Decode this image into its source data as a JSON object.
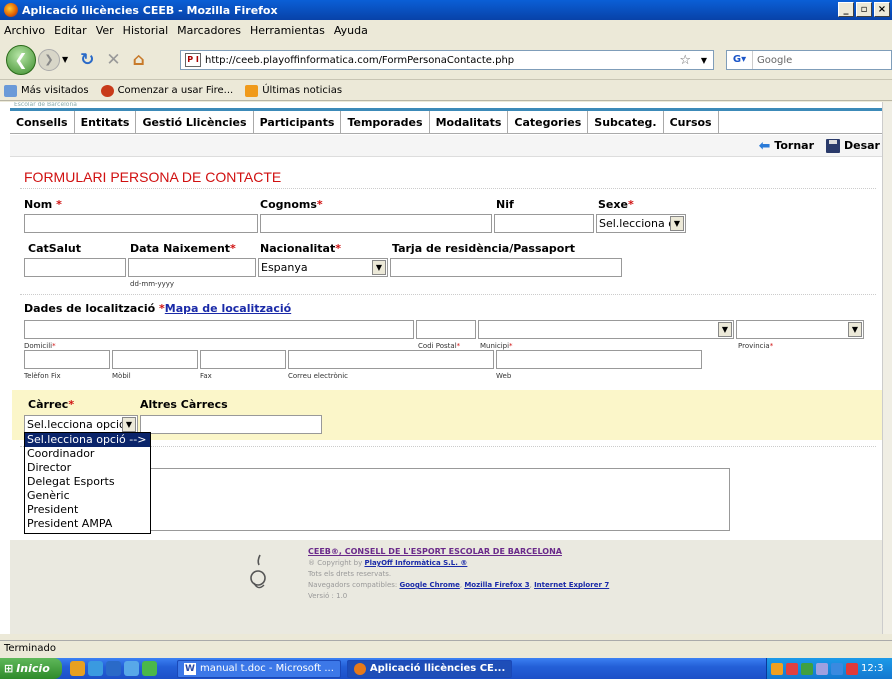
{
  "window": {
    "title": "Aplicació llicències CEEB - Mozilla Firefox"
  },
  "menu": [
    "Archivo",
    "Editar",
    "Ver",
    "Historial",
    "Marcadores",
    "Herramientas",
    "Ayuda"
  ],
  "nav": {
    "url": "http://ceeb.playoffinformatica.com/FormPersonaContacte.php",
    "favicon": "P I",
    "search_placeholder": "Google"
  },
  "bookmarks": [
    "Más visitados",
    "Comenzar a usar Fire...",
    "Últimas noticias"
  ],
  "site": {
    "subheader": "Escolar de Barcelona",
    "tabs": [
      "Consells",
      "Entitats",
      "Gestió Llicències",
      "Participants",
      "Temporades",
      "Modalitats",
      "Categories",
      "Subcateg.",
      "Cursos"
    ],
    "actions": {
      "back": "Tornar",
      "save": "Desar"
    }
  },
  "form": {
    "title": "FORMULARI PERSONA DE CONTACTE",
    "labels": {
      "nom": "Nom",
      "cognoms": "Cognoms",
      "nif": "Nif",
      "sexe": "Sexe",
      "catsalut": "CatSalut",
      "data_naixement": "Data Naixement",
      "nacionalitat": "Nacionalitat",
      "tarja": "Tarja de residència/Passaport",
      "dades": "Dades de localització",
      "mapa": "Mapa de localització",
      "carrec": "Càrrec",
      "altres": "Altres Càrrecs"
    },
    "required_mark": "*",
    "sexe_value": "Sel.lecciona o",
    "date_hint": "dd-mm-yyyy",
    "nacionalitat_value": "Espanya",
    "small_labels": {
      "domicili": "Domicili",
      "codi_postal": "Codi Postal",
      "municipi": "Municipi",
      "provincia": "Provincia",
      "telefon": "Telèfon Fix",
      "mobil": "Mòbil",
      "fax": "Fax",
      "correu": "Correu electrònic",
      "web": "Web"
    },
    "carrec_value": "Sel.lecciona opció",
    "carrec_options": [
      "Sel.lecciona opció -->",
      "Coordinador",
      "Director",
      "Delegat Esports",
      "Genèric",
      "President",
      "President AMPA"
    ]
  },
  "footer": {
    "org": "CEEB®, CONSELL DE L'ESPORT ESCOLAR DE BARCELONA",
    "copyright_prefix": "® Copyright by",
    "copyright_link": "PlayOff Informàtica S.L. ®",
    "rights": "Tots els drets reservats.",
    "browsers_prefix": "Navegadors compatibles:",
    "browsers": [
      "Google Chrome",
      "Mozilla Firefox 3",
      "Internet Explorer 7"
    ],
    "version": "Versió : 1.0"
  },
  "status": "Terminado",
  "taskbar": {
    "start": "Inicio",
    "windows": [
      "manual t.doc - Microsoft ...",
      "Aplicació llicències CE..."
    ],
    "clock": "12:3"
  }
}
